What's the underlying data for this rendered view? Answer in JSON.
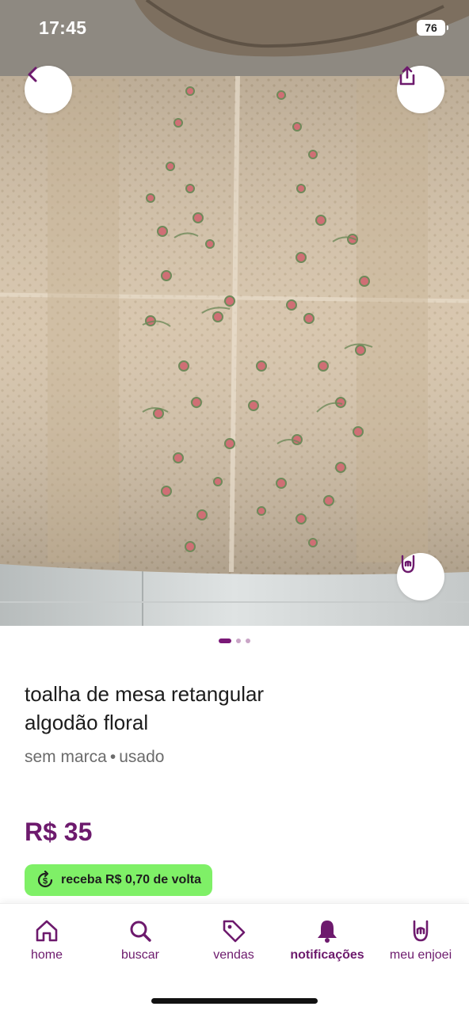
{
  "status_bar": {
    "time": "17:45",
    "battery": "76"
  },
  "photo": {
    "alt": "toalha de mesa"
  },
  "carousel": {
    "count": 3,
    "active": 0
  },
  "product": {
    "title_line1": "toalha de mesa retangular",
    "title_line2": "algodão floral",
    "brand": "sem marca",
    "separator": "•",
    "condition": "usado",
    "price": "R$ 35",
    "cashback": "receba R$ 0,70 de volta"
  },
  "nav": {
    "items": [
      {
        "label": "home",
        "icon": "home-icon"
      },
      {
        "label": "buscar",
        "icon": "search-icon"
      },
      {
        "label": "vendas",
        "icon": "tag-icon"
      },
      {
        "label": "notificações",
        "icon": "bell-icon",
        "active": true
      },
      {
        "label": "meu enjoei",
        "icon": "rock-hand-icon"
      }
    ]
  },
  "colors": {
    "brand": "#6d1a6d",
    "cashback_bg": "#7ff067",
    "dot_active": "#7a1877",
    "dot_inactive": "#c9a4c6"
  }
}
